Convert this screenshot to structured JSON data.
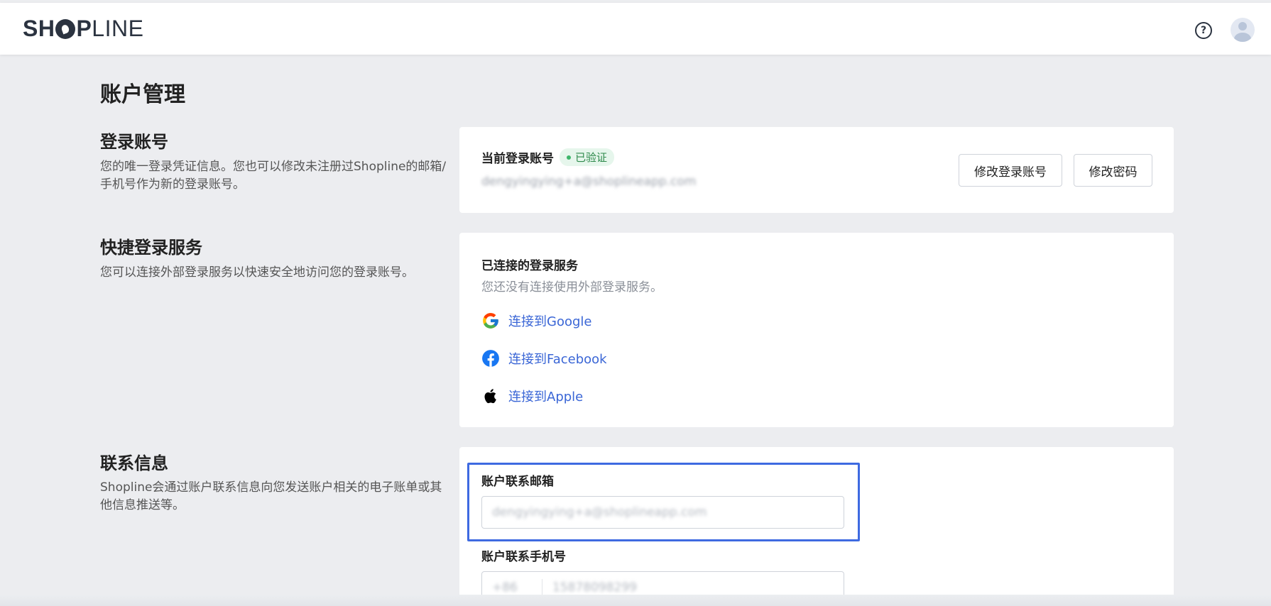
{
  "header": {
    "logo_bold_1": "SH",
    "logo_bold_2": "P",
    "logo_light": "LINE",
    "help_icon": "question-circle-icon",
    "avatar_icon": "user-avatar-icon"
  },
  "page": {
    "title": "账户管理"
  },
  "login_account": {
    "title": "登录账号",
    "description": "您的唯一登录凭证信息。您也可以修改未注册过Shopline的邮箱/手机号作为新的登录账号。",
    "card_label": "当前登录账号",
    "verified_badge": "已验证",
    "account_value": "dengyingying+a@shoplineapp.com",
    "change_account_button": "修改登录账号",
    "change_password_button": "修改密码"
  },
  "quick_login": {
    "title": "快捷登录服务",
    "description": "您可以连接外部登录服务以快速安全地访问您的登录账号。",
    "connected_label": "已连接的登录服务",
    "none_connected_text": "您还没有连接使用外部登录服务。",
    "providers": [
      {
        "label": "连接到Google",
        "icon": "google-icon"
      },
      {
        "label": "连接到Facebook",
        "icon": "facebook-icon"
      },
      {
        "label": "连接到Apple",
        "icon": "apple-icon"
      }
    ]
  },
  "contact_info": {
    "title": "联系信息",
    "description": "Shopline会通过账户联系信息向您发送账户相关的电子账单或其他信息推送等。",
    "email_label": "账户联系邮箱",
    "email_value": "dengyingying+a@shoplineapp.com",
    "phone_label": "账户联系手机号",
    "phone_code": "+86",
    "phone_value": "15878098299"
  },
  "colors": {
    "accent": "#3e6ae1",
    "link": "#3a66d6",
    "verified_bg": "#e6f6ec",
    "verified_text": "#2f8a4c",
    "page_bg": "#ecedf0"
  }
}
